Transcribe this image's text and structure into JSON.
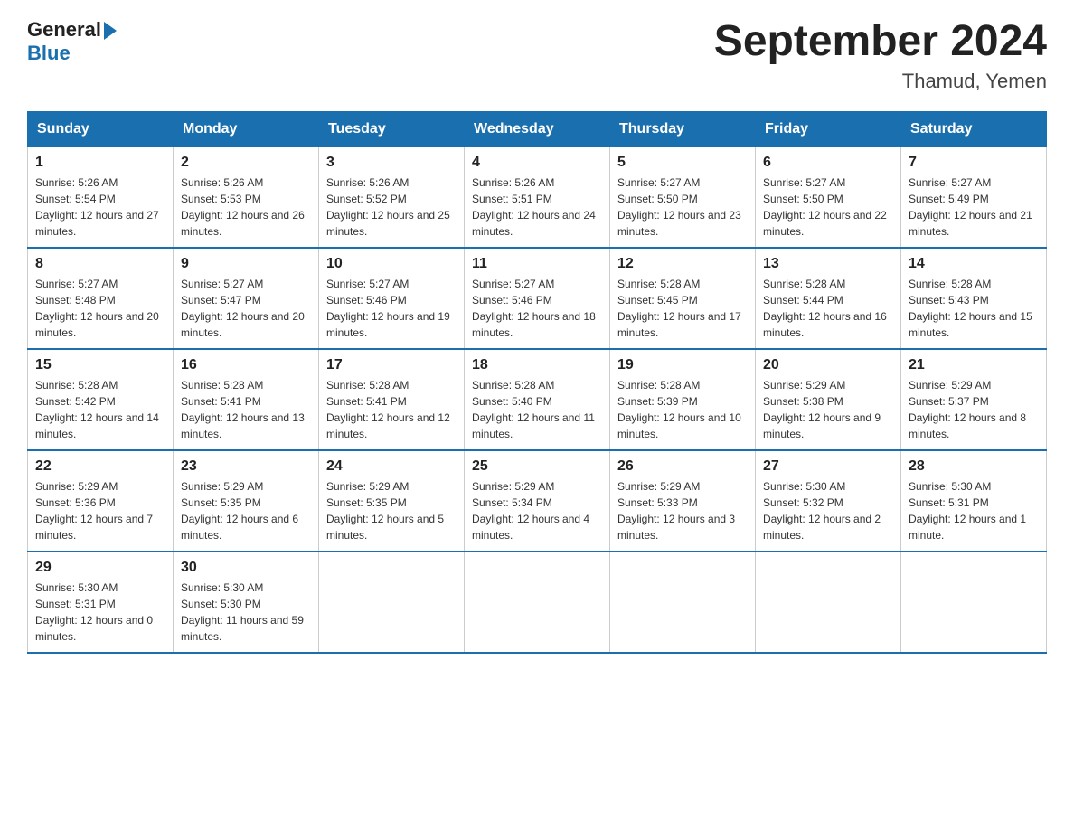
{
  "header": {
    "logo": {
      "general": "General",
      "blue": "Blue"
    },
    "title": "September 2024",
    "location": "Thamud, Yemen"
  },
  "calendar": {
    "days_of_week": [
      "Sunday",
      "Monday",
      "Tuesday",
      "Wednesday",
      "Thursday",
      "Friday",
      "Saturday"
    ],
    "weeks": [
      [
        {
          "day": "1",
          "sunrise": "Sunrise: 5:26 AM",
          "sunset": "Sunset: 5:54 PM",
          "daylight": "Daylight: 12 hours and 27 minutes."
        },
        {
          "day": "2",
          "sunrise": "Sunrise: 5:26 AM",
          "sunset": "Sunset: 5:53 PM",
          "daylight": "Daylight: 12 hours and 26 minutes."
        },
        {
          "day": "3",
          "sunrise": "Sunrise: 5:26 AM",
          "sunset": "Sunset: 5:52 PM",
          "daylight": "Daylight: 12 hours and 25 minutes."
        },
        {
          "day": "4",
          "sunrise": "Sunrise: 5:26 AM",
          "sunset": "Sunset: 5:51 PM",
          "daylight": "Daylight: 12 hours and 24 minutes."
        },
        {
          "day": "5",
          "sunrise": "Sunrise: 5:27 AM",
          "sunset": "Sunset: 5:50 PM",
          "daylight": "Daylight: 12 hours and 23 minutes."
        },
        {
          "day": "6",
          "sunrise": "Sunrise: 5:27 AM",
          "sunset": "Sunset: 5:50 PM",
          "daylight": "Daylight: 12 hours and 22 minutes."
        },
        {
          "day": "7",
          "sunrise": "Sunrise: 5:27 AM",
          "sunset": "Sunset: 5:49 PM",
          "daylight": "Daylight: 12 hours and 21 minutes."
        }
      ],
      [
        {
          "day": "8",
          "sunrise": "Sunrise: 5:27 AM",
          "sunset": "Sunset: 5:48 PM",
          "daylight": "Daylight: 12 hours and 20 minutes."
        },
        {
          "day": "9",
          "sunrise": "Sunrise: 5:27 AM",
          "sunset": "Sunset: 5:47 PM",
          "daylight": "Daylight: 12 hours and 20 minutes."
        },
        {
          "day": "10",
          "sunrise": "Sunrise: 5:27 AM",
          "sunset": "Sunset: 5:46 PM",
          "daylight": "Daylight: 12 hours and 19 minutes."
        },
        {
          "day": "11",
          "sunrise": "Sunrise: 5:27 AM",
          "sunset": "Sunset: 5:46 PM",
          "daylight": "Daylight: 12 hours and 18 minutes."
        },
        {
          "day": "12",
          "sunrise": "Sunrise: 5:28 AM",
          "sunset": "Sunset: 5:45 PM",
          "daylight": "Daylight: 12 hours and 17 minutes."
        },
        {
          "day": "13",
          "sunrise": "Sunrise: 5:28 AM",
          "sunset": "Sunset: 5:44 PM",
          "daylight": "Daylight: 12 hours and 16 minutes."
        },
        {
          "day": "14",
          "sunrise": "Sunrise: 5:28 AM",
          "sunset": "Sunset: 5:43 PM",
          "daylight": "Daylight: 12 hours and 15 minutes."
        }
      ],
      [
        {
          "day": "15",
          "sunrise": "Sunrise: 5:28 AM",
          "sunset": "Sunset: 5:42 PM",
          "daylight": "Daylight: 12 hours and 14 minutes."
        },
        {
          "day": "16",
          "sunrise": "Sunrise: 5:28 AM",
          "sunset": "Sunset: 5:41 PM",
          "daylight": "Daylight: 12 hours and 13 minutes."
        },
        {
          "day": "17",
          "sunrise": "Sunrise: 5:28 AM",
          "sunset": "Sunset: 5:41 PM",
          "daylight": "Daylight: 12 hours and 12 minutes."
        },
        {
          "day": "18",
          "sunrise": "Sunrise: 5:28 AM",
          "sunset": "Sunset: 5:40 PM",
          "daylight": "Daylight: 12 hours and 11 minutes."
        },
        {
          "day": "19",
          "sunrise": "Sunrise: 5:28 AM",
          "sunset": "Sunset: 5:39 PM",
          "daylight": "Daylight: 12 hours and 10 minutes."
        },
        {
          "day": "20",
          "sunrise": "Sunrise: 5:29 AM",
          "sunset": "Sunset: 5:38 PM",
          "daylight": "Daylight: 12 hours and 9 minutes."
        },
        {
          "day": "21",
          "sunrise": "Sunrise: 5:29 AM",
          "sunset": "Sunset: 5:37 PM",
          "daylight": "Daylight: 12 hours and 8 minutes."
        }
      ],
      [
        {
          "day": "22",
          "sunrise": "Sunrise: 5:29 AM",
          "sunset": "Sunset: 5:36 PM",
          "daylight": "Daylight: 12 hours and 7 minutes."
        },
        {
          "day": "23",
          "sunrise": "Sunrise: 5:29 AM",
          "sunset": "Sunset: 5:35 PM",
          "daylight": "Daylight: 12 hours and 6 minutes."
        },
        {
          "day": "24",
          "sunrise": "Sunrise: 5:29 AM",
          "sunset": "Sunset: 5:35 PM",
          "daylight": "Daylight: 12 hours and 5 minutes."
        },
        {
          "day": "25",
          "sunrise": "Sunrise: 5:29 AM",
          "sunset": "Sunset: 5:34 PM",
          "daylight": "Daylight: 12 hours and 4 minutes."
        },
        {
          "day": "26",
          "sunrise": "Sunrise: 5:29 AM",
          "sunset": "Sunset: 5:33 PM",
          "daylight": "Daylight: 12 hours and 3 minutes."
        },
        {
          "day": "27",
          "sunrise": "Sunrise: 5:30 AM",
          "sunset": "Sunset: 5:32 PM",
          "daylight": "Daylight: 12 hours and 2 minutes."
        },
        {
          "day": "28",
          "sunrise": "Sunrise: 5:30 AM",
          "sunset": "Sunset: 5:31 PM",
          "daylight": "Daylight: 12 hours and 1 minute."
        }
      ],
      [
        {
          "day": "29",
          "sunrise": "Sunrise: 5:30 AM",
          "sunset": "Sunset: 5:31 PM",
          "daylight": "Daylight: 12 hours and 0 minutes."
        },
        {
          "day": "30",
          "sunrise": "Sunrise: 5:30 AM",
          "sunset": "Sunset: 5:30 PM",
          "daylight": "Daylight: 11 hours and 59 minutes."
        },
        null,
        null,
        null,
        null,
        null
      ]
    ]
  }
}
